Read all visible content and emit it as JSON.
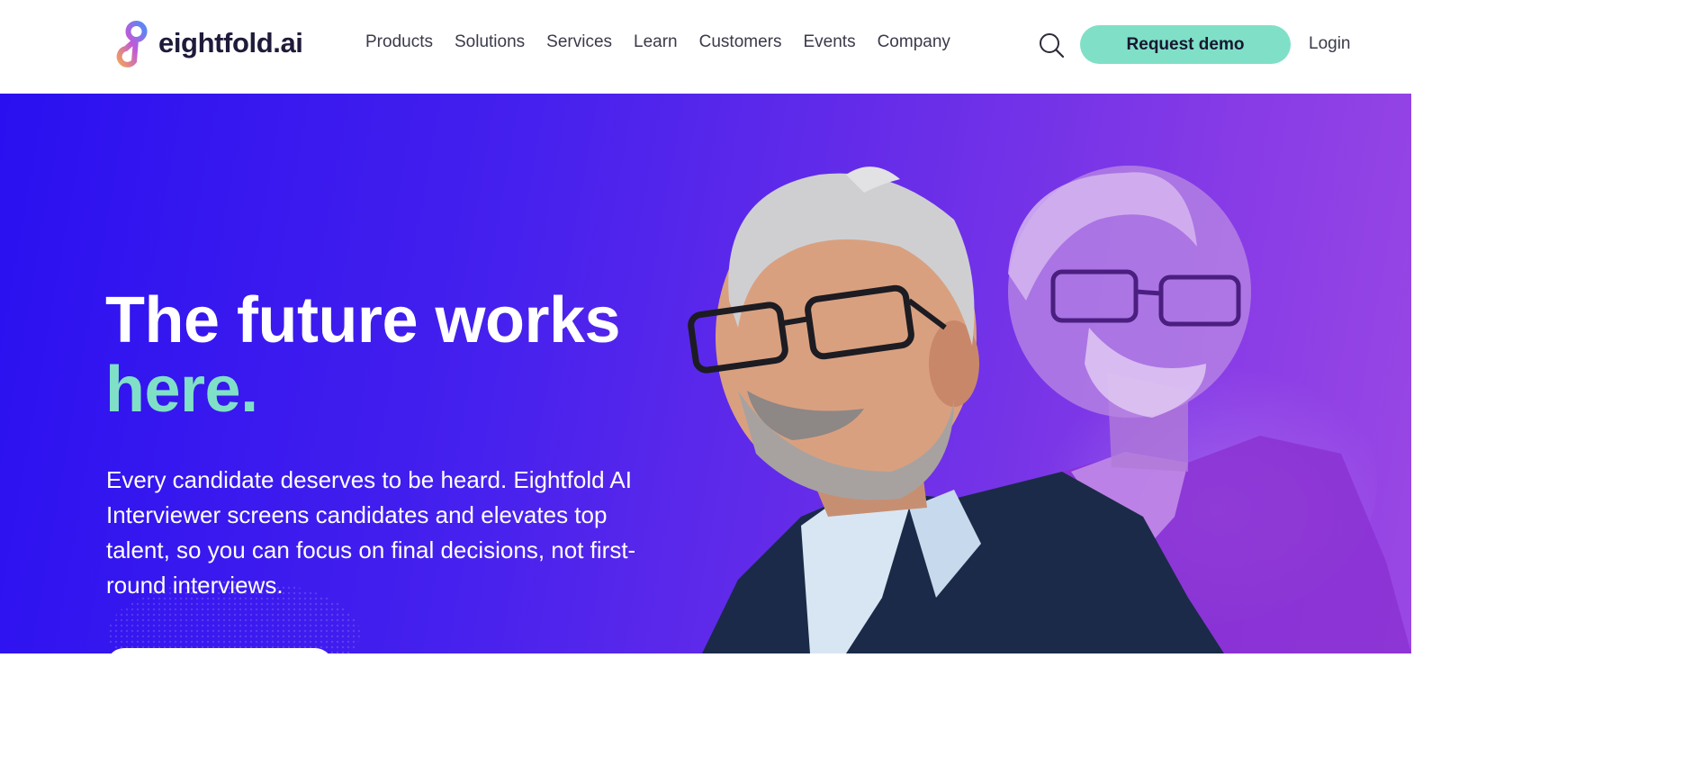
{
  "header": {
    "logo_text": "eightfold.ai",
    "nav": [
      "Products",
      "Solutions",
      "Services",
      "Learn",
      "Customers",
      "Events",
      "Company"
    ],
    "request_demo_label": "Request demo",
    "login_label": "Login",
    "search_icon": "search-icon"
  },
  "hero": {
    "headline_line1": "The future works",
    "headline_line2": "here.",
    "subtext": "Every candidate deserves to be heard. Eightfold AI Interviewer screens candidates and elevates top talent, so you can focus on final decisions, not first-round interviews."
  },
  "colors": {
    "accent": "#7fe0c7",
    "hero_gradient_start": "#2a10f0",
    "hero_gradient_end": "#9a48e4",
    "heading_dark": "#1e1b3a"
  }
}
